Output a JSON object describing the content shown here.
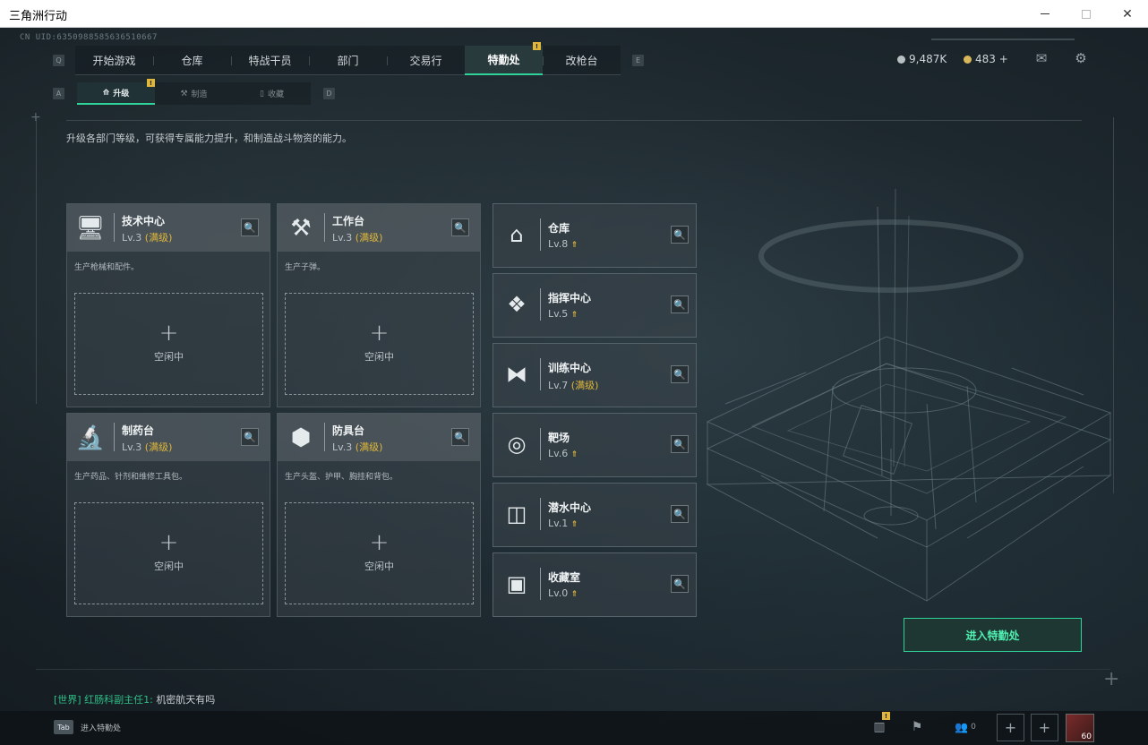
{
  "window": {
    "title": "三角洲行动"
  },
  "uid": "CN UID:6350988585636510667",
  "nav": {
    "left_key": "Q",
    "right_key": "E",
    "tabs": [
      {
        "label": "开始游戏",
        "active": false
      },
      {
        "label": "仓库",
        "active": false
      },
      {
        "label": "特战干员",
        "active": false
      },
      {
        "label": "部门",
        "active": false
      },
      {
        "label": "交易行",
        "active": false
      },
      {
        "label": "特勤处",
        "active": true,
        "badge": "!"
      },
      {
        "label": "改枪台",
        "active": false
      }
    ]
  },
  "currency": {
    "silver": "9,487K",
    "gold": "483 +"
  },
  "subnav": {
    "left_key": "A",
    "right_key": "D",
    "tabs": [
      {
        "label": "升级",
        "active": true,
        "badge": "!"
      },
      {
        "label": "制造",
        "active": false
      },
      {
        "label": "收藏",
        "active": false
      }
    ]
  },
  "description": "升级各部门等级，可获得专属能力提升，和制造战斗物资的能力。",
  "facilities": [
    {
      "name": "技术中心",
      "level": "Lv.3",
      "max": "(满级)",
      "desc": "生产枪械和配件。",
      "slot_plus": "+",
      "slot_status": "空闲中",
      "icon": "computer-icon"
    },
    {
      "name": "工作台",
      "level": "Lv.3",
      "max": "(满级)",
      "desc": "生产子弹。",
      "slot_plus": "+",
      "slot_status": "空闲中",
      "icon": "tools-icon"
    },
    {
      "name": "制药台",
      "level": "Lv.3",
      "max": "(满级)",
      "desc": "生产药品、针剂和维修工具包。",
      "slot_plus": "+",
      "slot_status": "空闲中",
      "icon": "microscope-icon"
    },
    {
      "name": "防具台",
      "level": "Lv.3",
      "max": "(满级)",
      "desc": "生产头盔、护甲、胸挂和背包。",
      "slot_plus": "+",
      "slot_status": "空闲中",
      "icon": "boxes-icon"
    }
  ],
  "right_list": [
    {
      "name": "仓库",
      "level": "Lv.8",
      "suffix": "",
      "upgradable": true,
      "icon": "warehouse-icon"
    },
    {
      "name": "指挥中心",
      "level": "Lv.5",
      "suffix": "",
      "upgradable": true,
      "icon": "command-icon"
    },
    {
      "name": "训练中心",
      "level": "Lv.7",
      "suffix": "(满级)",
      "upgradable": false,
      "icon": "dumbbell-icon"
    },
    {
      "name": "靶场",
      "level": "Lv.6",
      "suffix": "",
      "upgradable": true,
      "icon": "target-icon"
    },
    {
      "name": "潜水中心",
      "level": "Lv.1",
      "suffix": "",
      "upgradable": true,
      "icon": "goggles-icon"
    },
    {
      "name": "收藏室",
      "level": "Lv.0",
      "suffix": "",
      "upgradable": true,
      "icon": "collection-icon"
    }
  ],
  "enter_button": "进入特勤处",
  "chat": {
    "channel": "[世界]",
    "sender": "红肠科副主任1:",
    "message": "机密航天有吗"
  },
  "bottom": {
    "tab_key": "Tab",
    "tab_label": "进入特勤处",
    "stats_badge": "!",
    "friends_count": "0",
    "avatar_level": "60"
  },
  "colors": {
    "accent": "#2fd39a",
    "max_level": "#e0b73a"
  }
}
